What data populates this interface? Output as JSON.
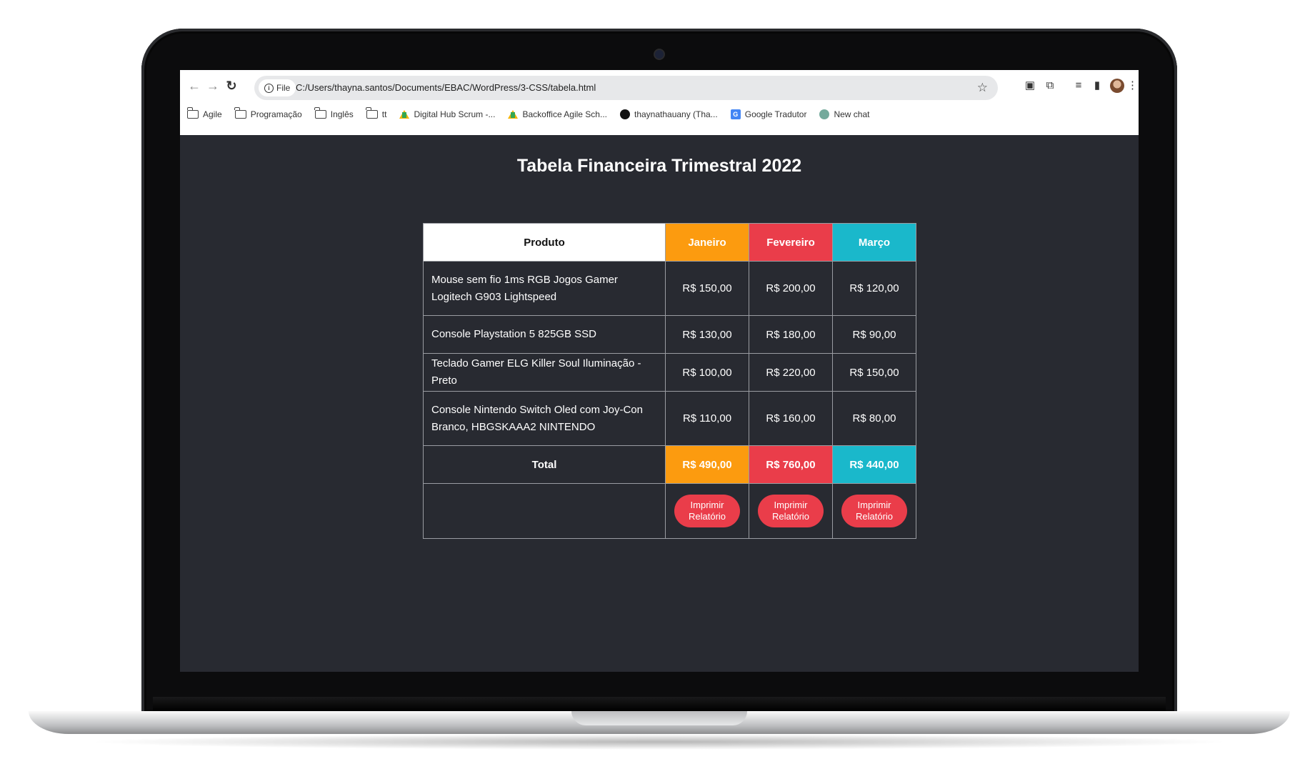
{
  "browser": {
    "file_chip": "File",
    "url": "C:/Users/thayna.santos/Documents/EBAC/WordPress/3-CSS/tabela.html",
    "bookmarks": [
      {
        "label": "Agile",
        "icon": "folder-icon"
      },
      {
        "label": "Programação",
        "icon": "folder-icon"
      },
      {
        "label": "Inglês",
        "icon": "folder-icon"
      },
      {
        "label": "tt",
        "icon": "folder-icon"
      },
      {
        "label": "Digital Hub Scrum -...",
        "icon": "drive-icon"
      },
      {
        "label": "Backoffice Agile Sch...",
        "icon": "drive-icon"
      },
      {
        "label": "thaynathauany (Tha...",
        "icon": "github-icon"
      },
      {
        "label": "Google Tradutor",
        "icon": "google-translate-icon"
      },
      {
        "label": "New chat",
        "icon": "chatgpt-icon"
      }
    ]
  },
  "page": {
    "title": "Tabela Financeira Trimestral 2022"
  },
  "table": {
    "headers": {
      "product": "Produto",
      "months": [
        "Janeiro",
        "Fevereiro",
        "Março"
      ]
    },
    "rows": [
      {
        "product": "Mouse sem fio 1ms RGB Jogos Gamer Logitech G903 Lightspeed",
        "values": [
          "R$ 150,00",
          "R$ 200,00",
          "R$ 120,00"
        ]
      },
      {
        "product": "Console Playstation 5 825GB SSD",
        "values": [
          "R$ 130,00",
          "R$ 180,00",
          "R$ 90,00"
        ]
      },
      {
        "product": "Teclado Gamer ELG Killer Soul Iluminação - Preto",
        "values": [
          "R$ 100,00",
          "R$ 220,00",
          "R$ 150,00"
        ]
      },
      {
        "product": "Console Nintendo Switch Oled com Joy-Con Branco, HBGSKAAA2 NINTENDO",
        "values": [
          "R$ 110,00",
          "R$ 160,00",
          "R$ 80,00"
        ]
      }
    ],
    "total": {
      "label": "Total",
      "values": [
        "R$ 490,00",
        "R$ 760,00",
        "R$ 440,00"
      ]
    },
    "print_button_label": "Imprimir Relatório"
  },
  "colors": {
    "janeiro": "#fc9b0f",
    "fevereiro": "#ea3d4a",
    "marco": "#1ab8cb",
    "page_background": "#282a31",
    "button": "#ea3d4a"
  }
}
